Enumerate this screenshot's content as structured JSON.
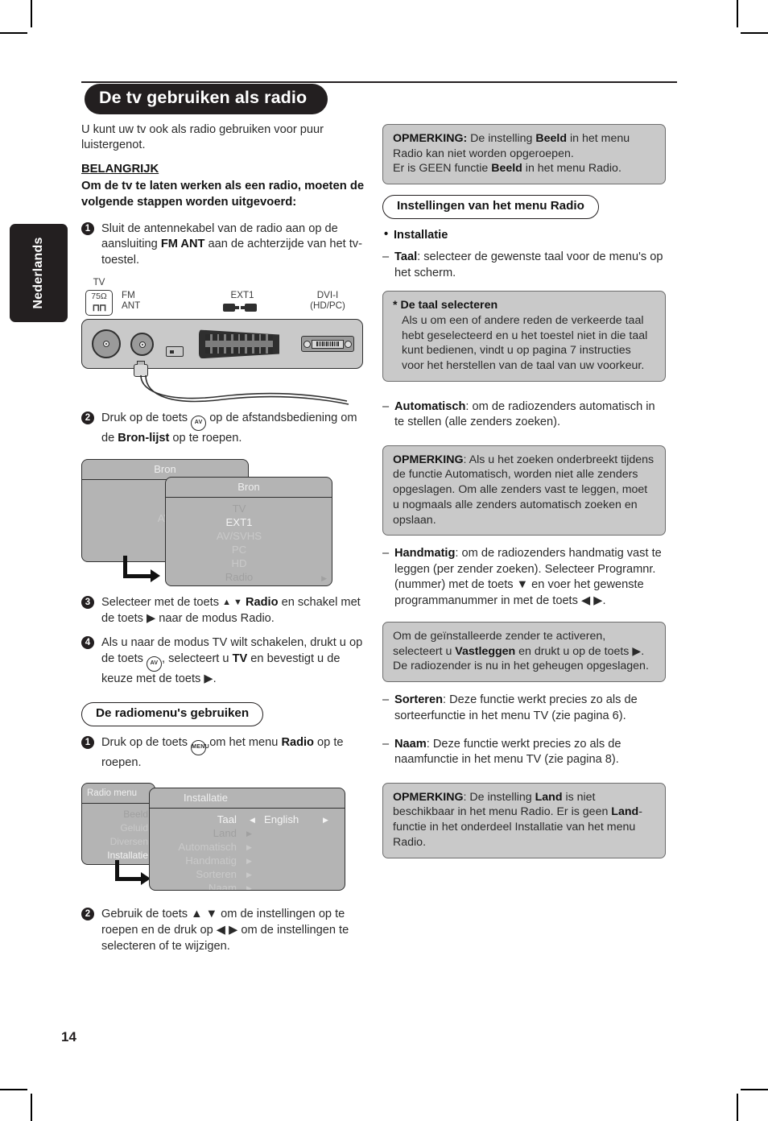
{
  "document": {
    "language_tab": "Nederlands",
    "page_number": "14",
    "title": "De tv gebruiken als radio"
  },
  "left_column": {
    "intro": "U kunt uw tv ook als radio gebruiken voor puur luistergenot.",
    "important_heading": "BELANGRIJK",
    "important_body": "Om de tv te laten werken als een radio, moeten de volgende stappen worden uitgevoerd:",
    "steps": [
      {
        "num": "1",
        "text_before": "Sluit de antennekabel van de radio aan op de aansluiting ",
        "bold": "FM ANT",
        "text_after": " aan de achterzijde van het tv-toestel."
      },
      {
        "num": "2",
        "text_before": "Druk op de toets ",
        "key": "AV",
        "text_mid": " op de afstandsbediening om de ",
        "bold": "Bron-lijst",
        "text_after": " op te roepen."
      },
      {
        "num": "3",
        "text_before": "Selecteer met de toets ",
        "arrows1": "▲ ▼",
        "text_mid": " ",
        "bold": "Radio",
        "text_after": " en schakel met de toets ▶ naar de modus Radio."
      },
      {
        "num": "4",
        "text_before": "Als u naar de modus TV wilt schakelen, drukt u op de toets ",
        "key": "AV",
        "text_mid": ", selecteert u ",
        "bold": "TV",
        "text_after": " en bevestigt u de keuze met de toets ▶."
      }
    ],
    "connector_panel": {
      "tv_label": "TV",
      "tv_impedance": "75Ω",
      "fm_label": "FM\nANT",
      "ext1_label": "EXT1",
      "dvi_label": "DVI-I\n(HD/PC)"
    },
    "source_menu": {
      "back_title": "Bron",
      "back_items": [
        "TV",
        "EXT1",
        "AV/SVHS",
        "PC",
        "HD",
        "Radio"
      ],
      "front_title": "Bron",
      "front_items": [
        "TV",
        "EXT1",
        "AV/SVHS",
        "PC",
        "HD",
        "Radio"
      ]
    },
    "radio_menu_heading": "De radiomenu's gebruiken",
    "radio_steps": [
      {
        "num": "1",
        "text_before": "Druk op de toets ",
        "key": "MENU",
        "text_mid": " om het menu ",
        "bold": "Radio",
        "text_after": " op te roepen."
      },
      {
        "num": "2",
        "text_before": "Gebruik de toets ▲ ▼ om de instellingen op te roepen en de druk op ◀ ▶ om de instellingen te selecteren of te wijzigen.",
        "bold": "",
        "text_after": ""
      }
    ],
    "radio_menu_osd": {
      "left_title": "Radio menu",
      "left_items": [
        "Beeld",
        "Geluid",
        "Diversen",
        "Installatie"
      ],
      "right_title": "Installatie",
      "right_items": [
        "Taal",
        "Land",
        "Automatisch",
        "Handmatig",
        "Sorteren",
        "Naam"
      ],
      "taal_value": "English"
    }
  },
  "right_column": {
    "note_beeld": {
      "label": "OPMERKING:",
      "line1_a": " De instelling ",
      "line1_b": "Beeld",
      "line1_c": " in het menu Radio kan niet worden opgeroepen.",
      "line2_a": "Er is GEEN functie ",
      "line2_b": "Beeld",
      "line2_c": " in het menu Radio."
    },
    "settings_heading": "Instellingen van het menu Radio",
    "installatie_bullet": "Installatie",
    "taal_item": {
      "term": "Taal",
      "body": ": selecteer de gewenste taal voor de menu's op het scherm."
    },
    "note_taal": {
      "heading": "* De taal selecteren",
      "body": "Als u om een of andere reden de verkeerde taal hebt geselecteerd en u het toestel niet in die taal kunt bedienen, vindt u op pagina 7 instructies voor het herstellen van de taal van uw voorkeur."
    },
    "automatisch_item": {
      "term": "Automatisch",
      "body": ": om de radiozenders automatisch in te stellen (alle zenders zoeken)."
    },
    "note_automatisch": {
      "label": "OPMERKING",
      "body": ": Als u het zoeken onderbreekt tijdens de functie Automatisch, worden niet alle zenders opgeslagen. Om alle zenders vast te leggen, moet u nogmaals alle zenders automatisch zoeken en opslaan."
    },
    "handmatig_item": {
      "term": "Handmatig",
      "body": ": om de radiozenders handmatig vast te leggen (per zender zoeken). Selecteer Programnr. (nummer) met de toets ▼ en voer het gewenste programmanummer in met de toets ◀ ▶."
    },
    "note_vastleggen": {
      "part1": "Om de geïnstalleerde zender te activeren, selecteert u ",
      "bold": "Vastleggen",
      "part2": " en drukt u op de toets ▶. De radiozender is nu in het geheugen opgeslagen."
    },
    "sorteren_item": {
      "term": "Sorteren",
      "body": ": Deze functie werkt precies zo als de sorteerfunctie in het menu TV (zie pagina 6)."
    },
    "naam_item": {
      "term": "Naam",
      "body": ": Deze functie werkt precies zo als de naamfunctie in het menu TV (zie pagina 8)."
    },
    "note_land": {
      "label": "OPMERKING",
      "part1": ": De instelling ",
      "bold1": "Land",
      "part2": " is niet beschikbaar in het menu Radio. Er is geen ",
      "bold2": "Land",
      "part3": "-functie in het onderdeel Installatie van het menu Radio."
    }
  },
  "colors": {
    "ink": "#231f20",
    "note_bg": "#c9c9c9",
    "note_border": "#6d6d6d",
    "osd_bg": "#b4b4b4"
  }
}
